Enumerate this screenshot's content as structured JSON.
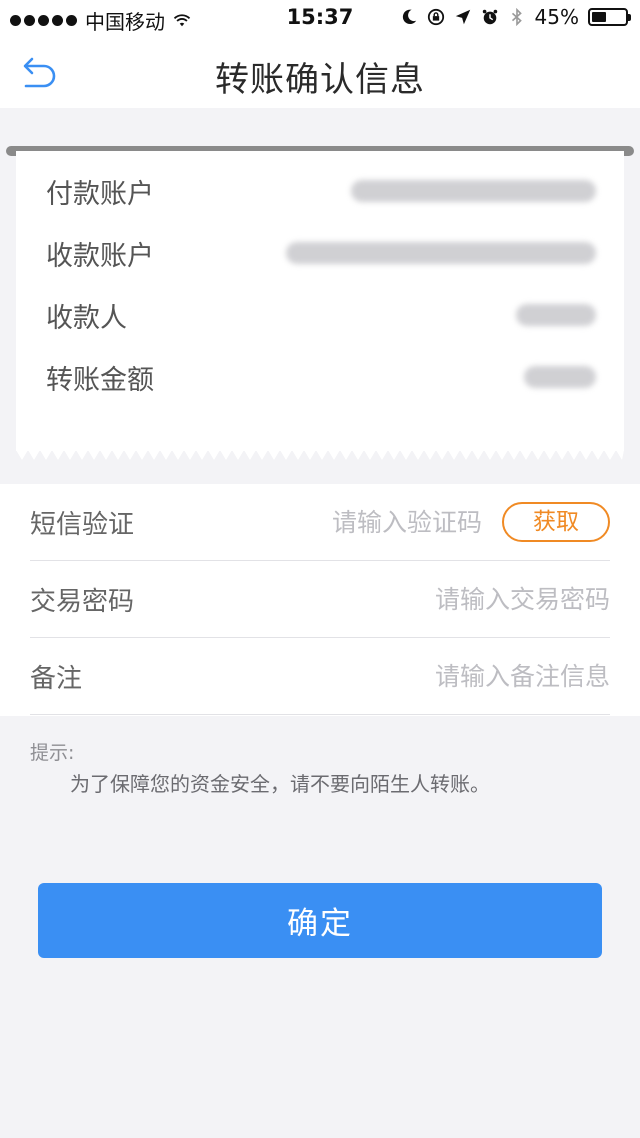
{
  "status_bar": {
    "carrier": "中国移动",
    "time": "15:37",
    "battery_percent_label": "45%",
    "battery_level": 0.45,
    "icons": [
      "signal-dots-icon",
      "wifi-icon",
      "moon-icon",
      "orientation-lock-icon",
      "location-arrow-icon",
      "alarm-icon",
      "bluetooth-icon",
      "battery-icon"
    ]
  },
  "nav": {
    "back_icon": "back-arrow-icon",
    "title": "转账确认信息"
  },
  "receipt": {
    "rows": [
      {
        "label": "付款账户"
      },
      {
        "label": "收款账户"
      },
      {
        "label": "收款人"
      },
      {
        "label": "转账金额"
      }
    ]
  },
  "form": {
    "sms": {
      "label": "短信验证",
      "placeholder": "请输入验证码",
      "value": "",
      "button": "获取"
    },
    "password": {
      "label": "交易密码",
      "placeholder": "请输入交易密码",
      "value": ""
    },
    "note": {
      "label": "备注",
      "placeholder": "请输入备注信息",
      "value": ""
    }
  },
  "tip": {
    "title": "提示:",
    "text": "为了保障您的资金安全，请不要向陌生人转账。"
  },
  "confirm": {
    "label": "确定"
  },
  "colors": {
    "accent": "#3a8ff3",
    "get_code": "#f08a24",
    "background": "#f3f3f6"
  }
}
